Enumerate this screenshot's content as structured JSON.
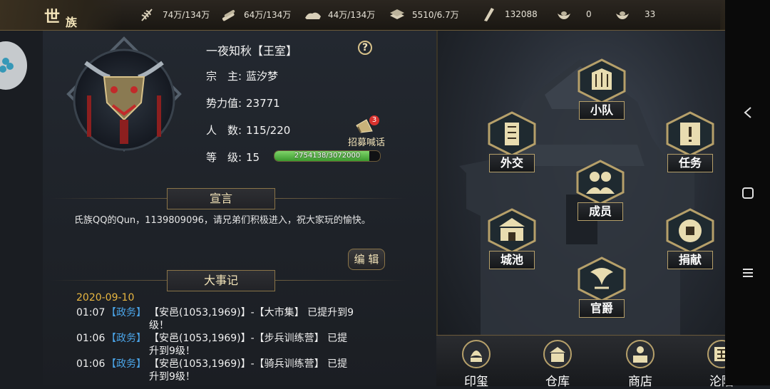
{
  "topbar": {
    "clan_tab_char1": "世",
    "clan_tab_char2": "族",
    "resources": [
      {
        "icon": "grain-icon",
        "value": "74万/134万"
      },
      {
        "icon": "wood-icon",
        "value": "64万/134万"
      },
      {
        "icon": "stone-icon",
        "value": "44万/134万"
      },
      {
        "icon": "iron-icon",
        "value": "5510/6.7万"
      },
      {
        "icon": "order-token-icon",
        "value": "132088"
      },
      {
        "icon": "gold-ingot-icon",
        "value": "0"
      },
      {
        "icon": "silver-ingot-icon",
        "value": "33"
      }
    ]
  },
  "clan": {
    "name": "一夜知秋【王室】",
    "leader_label": "宗　主:",
    "leader": "蓝汐梦",
    "power_label": "势力值:",
    "power": "23771",
    "members_label": "人　数:",
    "members": "115/220",
    "level_label": "等　级:",
    "level": "15",
    "exp_text": "2754138/3072000",
    "exp_fraction": 0.8965,
    "recruit_label": "招募喊话",
    "recruit_badge": "3",
    "help_symbol": "?"
  },
  "declaration": {
    "title": "宣言",
    "text": "氏族QQ的Qun，1139809096，请兄弟们积极进入，祝大家玩的愉快。",
    "edit_label": "编 辑"
  },
  "events": {
    "title": "大事记",
    "date": "2020-09-10",
    "items": [
      {
        "time": "01:07",
        "category": "【政务】",
        "text": "【安邑(1053,1969)】-【大市集】 已提升到9级！"
      },
      {
        "time": "01:06",
        "category": "【政务】",
        "text": "【安邑(1053,1969)】-【步兵训练营】 已提升到9级！"
      },
      {
        "time": "01:06",
        "category": "【政务】",
        "text": "【安邑(1053,1969)】-【骑兵训练营】 已提升到9级！"
      }
    ]
  },
  "map_buttons": {
    "squad": "小队",
    "diplomacy": "外交",
    "mission": "任务",
    "members": "成员",
    "city": "城池",
    "donate": "捐献",
    "rank": "官爵"
  },
  "bottom_tabs": [
    "印玺",
    "仓库",
    "商店",
    "沦陷"
  ],
  "colors": {
    "gold_text": "#f2e3b8",
    "date_text": "#e8b640",
    "category_text": "#4aa3e6",
    "exp_green": "#5fbf4a",
    "badge_red": "#d8322e"
  }
}
